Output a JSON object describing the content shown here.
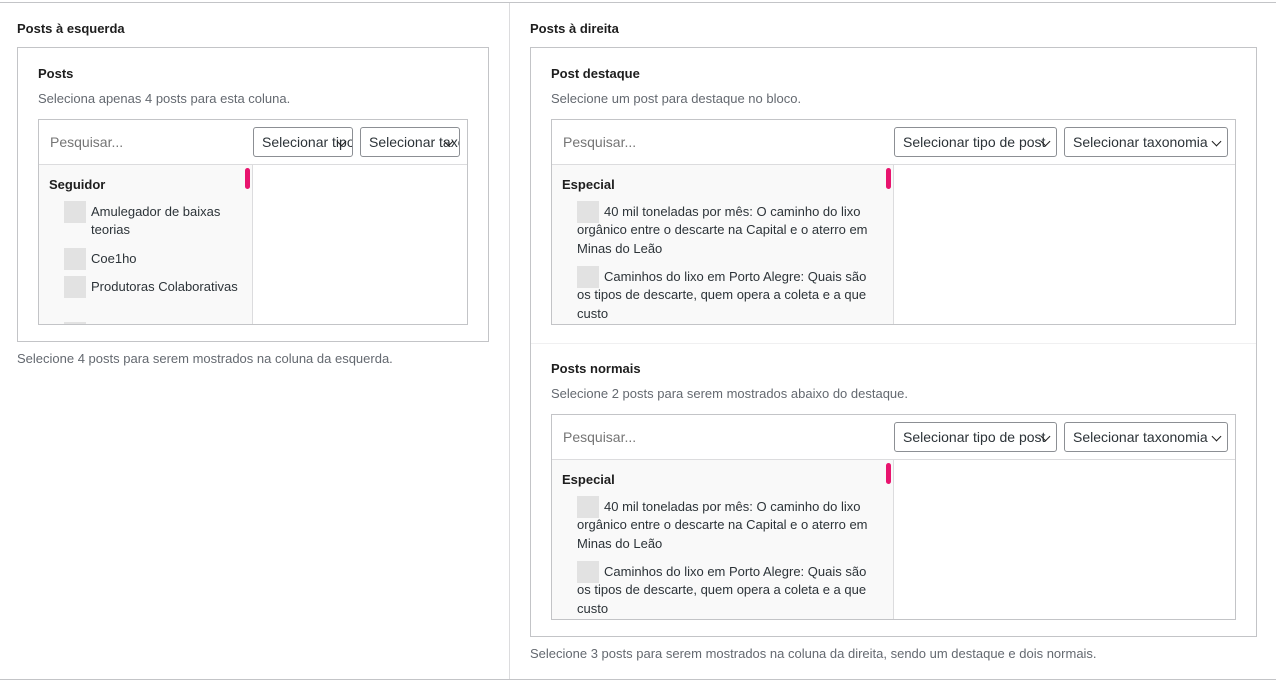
{
  "left": {
    "column_title": "Posts à esquerda",
    "help": "Selecione 4 posts para serem mostrados na coluna da esquerda.",
    "field": {
      "title": "Posts",
      "description": "Seleciona apenas 4 posts para esta coluna.",
      "search_placeholder": "Pesquisar...",
      "select_post_type": "Selecionar tipo de post",
      "select_taxonomy": "Selecionar taxonomia",
      "group": "Seguidor",
      "items": [
        "Amulegador de baixas teorias",
        "Coe1ho",
        "Produtoras Colaborativas"
      ]
    }
  },
  "right": {
    "column_title": "Posts à direita",
    "help": "Selecione 3 posts para serem mostrados na coluna da direita, sendo um destaque e dois normais.",
    "featured": {
      "title": "Post destaque",
      "description": "Selecione um post para destaque no bloco.",
      "search_placeholder": "Pesquisar...",
      "select_post_type": "Selecionar tipo de post",
      "select_taxonomy": "Selecionar taxonomia",
      "group": "Especial",
      "items": [
        "40 mil toneladas por mês: O caminho do lixo orgânico entre o descarte na Capital e o aterro em Minas do Leão",
        "Caminhos do lixo em Porto Alegre: Quais são os tipos de descarte, quem opera a coleta e a que custo"
      ]
    },
    "normal": {
      "title": "Posts normais",
      "description": "Selecione 2 posts para serem mostrados abaixo do destaque.",
      "search_placeholder": "Pesquisar...",
      "select_post_type": "Selecionar tipo de post",
      "select_taxonomy": "Selecionar taxonomia",
      "group": "Especial",
      "items": [
        "40 mil toneladas por mês: O caminho do lixo orgânico entre o descarte na Capital e o aterro em Minas do Leão",
        "Caminhos do lixo em Porto Alegre: Quais são os tipos de descarte, quem opera a coleta e a que custo"
      ]
    }
  },
  "colors": {
    "scroll_accent": "#e8146e",
    "border": "#c3c4c7",
    "muted_text": "#646970"
  }
}
